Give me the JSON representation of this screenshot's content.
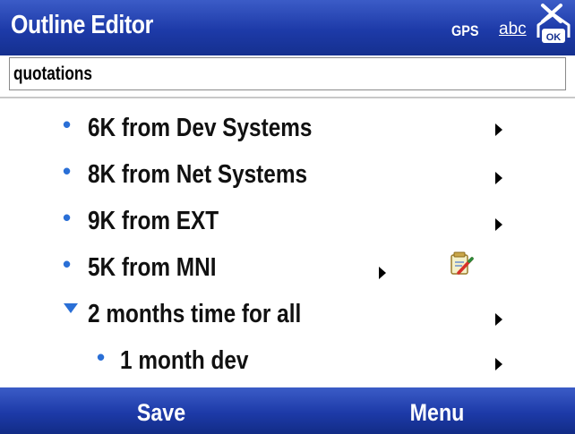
{
  "window": {
    "title": "Outline Editor"
  },
  "status": {
    "gps": "GPS",
    "input_mode": "abc"
  },
  "title_field": {
    "value": "quotations"
  },
  "items": [
    {
      "label": "6K from Dev Systems",
      "level": 1,
      "marker": "bullet"
    },
    {
      "label": "8K from Net Systems",
      "level": 1,
      "marker": "bullet"
    },
    {
      "label": "9K from EXT",
      "level": 1,
      "marker": "bullet"
    },
    {
      "label": "5K from MNI",
      "level": 1,
      "marker": "bullet",
      "has_note": true
    },
    {
      "label": "2 months time for all",
      "level": 1,
      "marker": "expanded"
    },
    {
      "label": "1 month dev",
      "level": 2,
      "marker": "bullet"
    }
  ],
  "softkeys": {
    "left": "Save",
    "right": "Menu"
  },
  "colors": {
    "bar": "#1d3aa8",
    "bullet": "#2a6fd6"
  }
}
